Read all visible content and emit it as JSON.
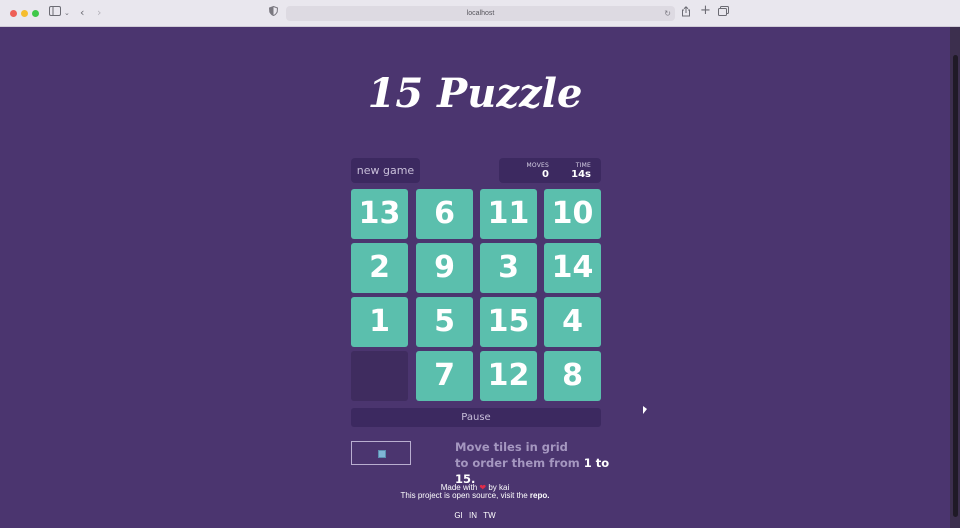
{
  "browser": {
    "url": "localhost",
    "icons": {
      "sidebar": "sidebar-icon",
      "back": "back-icon",
      "forward": "forward-icon",
      "shield": "shield-icon",
      "reload": "reload-icon",
      "share": "share-icon",
      "new_tab": "plus-icon",
      "tabs": "tabs-overview-icon"
    }
  },
  "game": {
    "title": "15 Puzzle",
    "new_game_label": "new game",
    "moves_label": "MOVES",
    "moves_value": "0",
    "time_label": "TIME",
    "time_value": "14s",
    "tiles": [
      "13",
      "6",
      "11",
      "10",
      "2",
      "9",
      "3",
      "14",
      "1",
      "5",
      "15",
      "4",
      "",
      "7",
      "12",
      "8"
    ],
    "pause_label": "Pause",
    "instruction_line1": "Move tiles in grid",
    "instruction_line2_prefix": "to order them from ",
    "instruction_line2_bold": "1 to 15."
  },
  "footer": {
    "made_with": "Made with",
    "by": "by kai",
    "open_source": "This project is open source, visit the",
    "repo_link": "repo.",
    "social": [
      "GI",
      "IN",
      "TW"
    ]
  },
  "colors": {
    "background": "#4b356f",
    "tile": "#5bbfad",
    "blank_tile": "#3f2c5f",
    "panel": "#3c2960"
  }
}
